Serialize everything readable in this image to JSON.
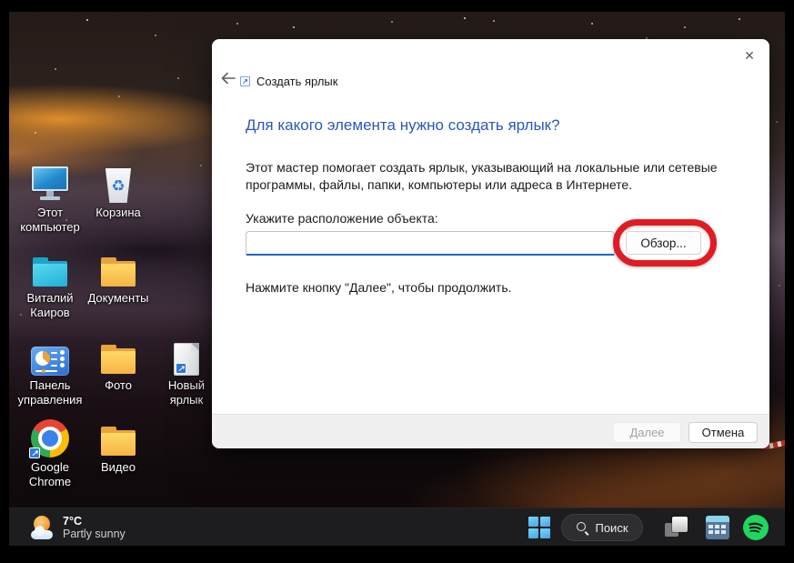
{
  "desktop": {
    "icons": [
      {
        "name": "this-pc",
        "label": "Этот компьютер"
      },
      {
        "name": "recycle-bin",
        "label": "Корзина"
      },
      {
        "name": "user-folder",
        "label": "Виталий Каиров"
      },
      {
        "name": "documents",
        "label": "Документы"
      },
      {
        "name": "control-panel",
        "label": "Панель управления"
      },
      {
        "name": "photos",
        "label": "Фото"
      },
      {
        "name": "new-shortcut",
        "label": "Новый ярлык"
      },
      {
        "name": "google-chrome",
        "label": "Google Chrome"
      },
      {
        "name": "videos",
        "label": "Видео"
      }
    ]
  },
  "dialog": {
    "window_title": "Создать ярлык",
    "heading": "Для какого элемента нужно создать ярлык?",
    "description": "Этот мастер помогает создать ярлык, указывающий на локальные или сетевые программы, файлы, папки, компьютеры или адреса в Интернете.",
    "location_label": "Укажите расположение объекта:",
    "location_value": "",
    "hint": "Нажмите кнопку \"Далее\", чтобы продолжить.",
    "buttons": {
      "browse": "Обзор...",
      "next": "Далее",
      "cancel": "Отмена"
    },
    "next_disabled": true
  },
  "annotation": {
    "shape": "rounded-rectangle",
    "color": "#e11b22",
    "target": "browse-button"
  },
  "taskbar": {
    "weather": {
      "temperature": "7°C",
      "condition": "Partly sunny"
    },
    "search_label": "Поиск"
  },
  "colors": {
    "dialog_heading": "#2a58b9",
    "input_focus_underline": "#2066c0",
    "annotation_red": "#e11b22",
    "spotify_green": "#1ed760",
    "taskbar_bg": "#1d1d1f"
  }
}
